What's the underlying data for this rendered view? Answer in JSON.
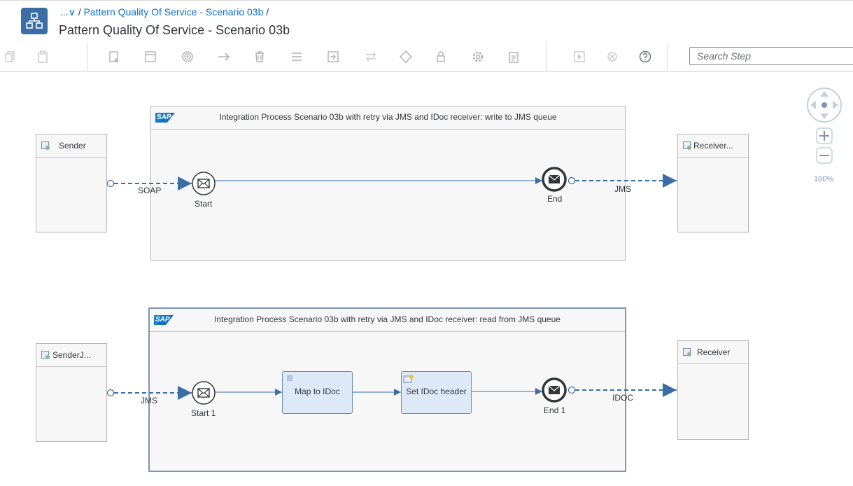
{
  "header": {
    "breadcrumb_more": "...",
    "breadcrumb_link": "Pattern Quality Of Service - Scenario 03b",
    "breadcrumb_sep": "/",
    "title": "Pattern Quality Of Service - Scenario 03b",
    "app_icon": "integration-flow-icon"
  },
  "toolbar": {
    "search_placeholder": "Search Step",
    "icons": [
      "copy-icon",
      "paste-icon",
      "add-step-icon",
      "pool-icon",
      "event-icon",
      "connector-icon",
      "delete-icon",
      "menu-icon",
      "import-icon",
      "swap-icon",
      "gateway-icon",
      "lock-icon",
      "settings-icon",
      "clipboard-icon",
      "simulate-icon",
      "stop-icon",
      "help-icon"
    ]
  },
  "canvas": {
    "zoom": "100%",
    "pool1": {
      "title": "Integration Process Scenario 03b with retry via JMS and IDoc receiver: write to JMS queue",
      "sender": "Sender",
      "receiver": "Receiver...",
      "start": "Start",
      "end": "End",
      "in_adapter": "SOAP",
      "out_adapter": "JMS"
    },
    "pool2": {
      "title": "Integration Process Scenario 03b with retry via JMS and IDoc receiver: read from JMS queue",
      "sender": "SenderJ...",
      "receiver": "Receiver",
      "start": "Start 1",
      "step1": "Map to IDoc",
      "step2": "Set IDoc header",
      "end": "End 1",
      "in_adapter": "JMS",
      "out_adapter": "IDOC"
    }
  },
  "colors": {
    "link": "#0a6ed1",
    "flow": "#3a6ea5",
    "step_fill": "#dde9f7",
    "app_icon": "#3a6ea5"
  }
}
